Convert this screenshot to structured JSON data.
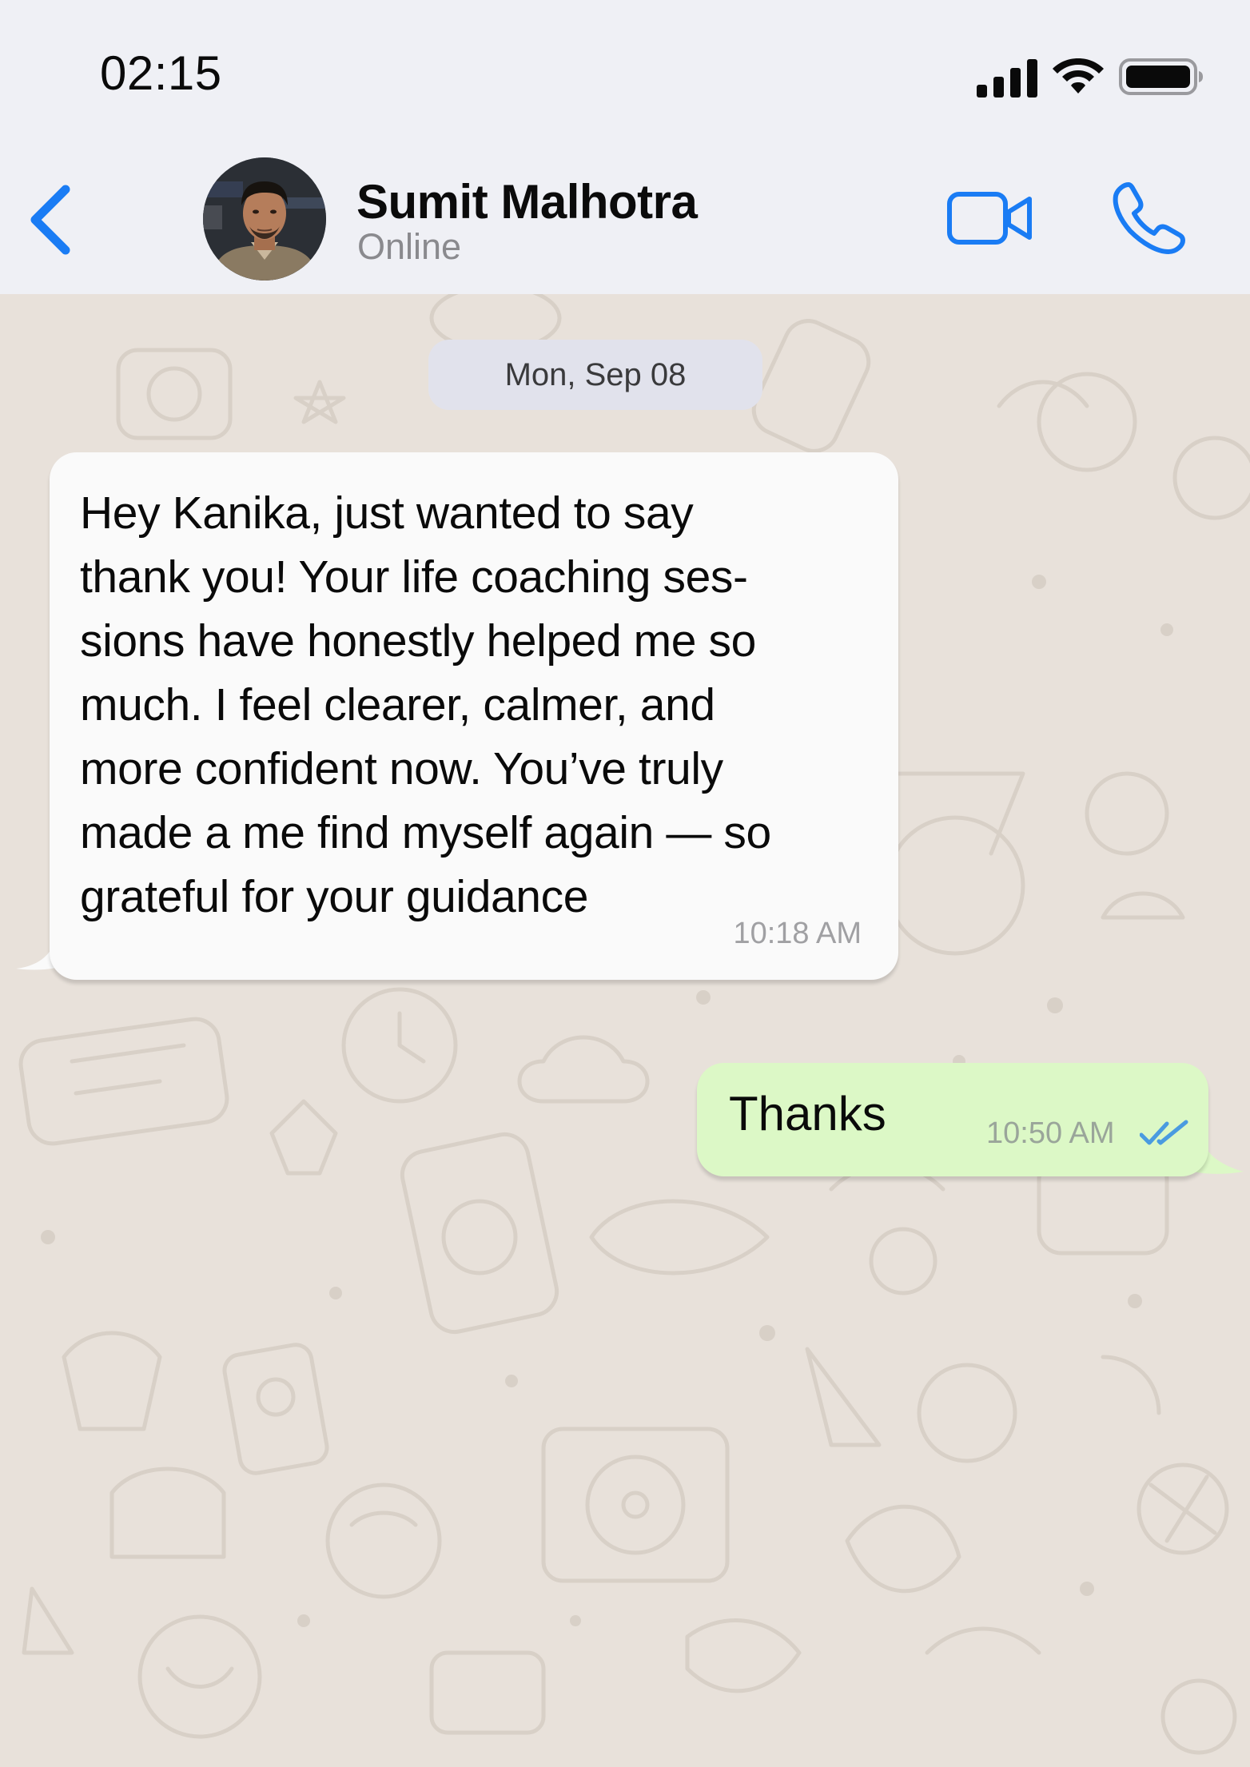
{
  "status_bar": {
    "time": "02:15",
    "icons": [
      "signal-icon",
      "wifi-icon",
      "battery-icon"
    ]
  },
  "header": {
    "back_icon": "chevron-left-icon",
    "contact_name": "Sumit Malhotra",
    "contact_status": "Online",
    "actions": [
      "video-call-icon",
      "phone-icon"
    ]
  },
  "chat": {
    "date_separator": "Mon, Sep 08",
    "messages": [
      {
        "direction": "incoming",
        "text": "Hey Kanika, just wanted to say\nthank you! Your life coaching ses-\nsions have honestly helped me so\nmuch. I feel clearer, calmer, and\nmore confident now. You’ve truly\nmade a me find myself again — so\ngrateful for your guidance",
        "time": "10:18 AM"
      },
      {
        "direction": "outgoing",
        "text": "Thanks",
        "time": "10:50 AM",
        "receipt_icon": "double-check-icon",
        "status": "read"
      }
    ]
  },
  "colors": {
    "accent": "#1a7cf4",
    "header_bg": "#eff0f5",
    "chat_bg": "#e8e1da",
    "incoming_bubble": "#fafafa",
    "outgoing_bubble": "#dcf8c6",
    "date_chip": "#e1e2ec",
    "read_receipt": "#4a9be0"
  }
}
